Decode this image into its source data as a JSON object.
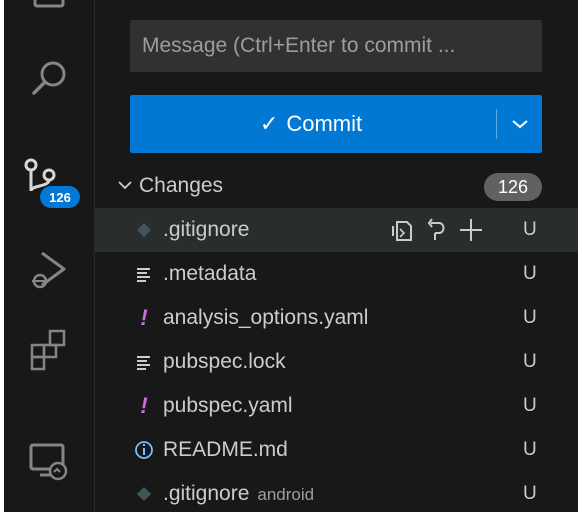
{
  "activity_bar": {
    "scm_badge": "126",
    "icons": [
      "explorer-icon",
      "search-icon",
      "source-control-icon",
      "run-debug-icon",
      "extensions-icon",
      "remote-explorer-icon"
    ]
  },
  "commit_message": {
    "placeholder": "Message (Ctrl+Enter to commit ..."
  },
  "commit_button": {
    "label": "Commit",
    "check_glyph": "✓"
  },
  "changes": {
    "label": "Changes",
    "count": "126",
    "files": [
      {
        "name": ".gitignore",
        "dir": "",
        "status": "U",
        "icon": "git-file-icon",
        "selected": true
      },
      {
        "name": ".metadata",
        "dir": "",
        "status": "U",
        "icon": "text-lines-icon",
        "selected": false
      },
      {
        "name": "analysis_options.yaml",
        "dir": "",
        "status": "U",
        "icon": "yaml-exclamation-icon",
        "selected": false
      },
      {
        "name": "pubspec.lock",
        "dir": "",
        "status": "U",
        "icon": "text-lines-icon",
        "selected": false
      },
      {
        "name": "pubspec.yaml",
        "dir": "",
        "status": "U",
        "icon": "yaml-exclamation-icon",
        "selected": false
      },
      {
        "name": "README.md",
        "dir": "",
        "status": "U",
        "icon": "info-icon",
        "selected": false
      },
      {
        "name": ".gitignore",
        "dir": "android",
        "status": "U",
        "icon": "git-file-icon",
        "selected": false
      }
    ]
  },
  "colors": {
    "background": "#181818",
    "accent": "#0078d4",
    "input_bg": "#313131",
    "yaml_icon": "#c66fdb",
    "info_icon": "#75beff",
    "git_icon": "#41535b"
  }
}
